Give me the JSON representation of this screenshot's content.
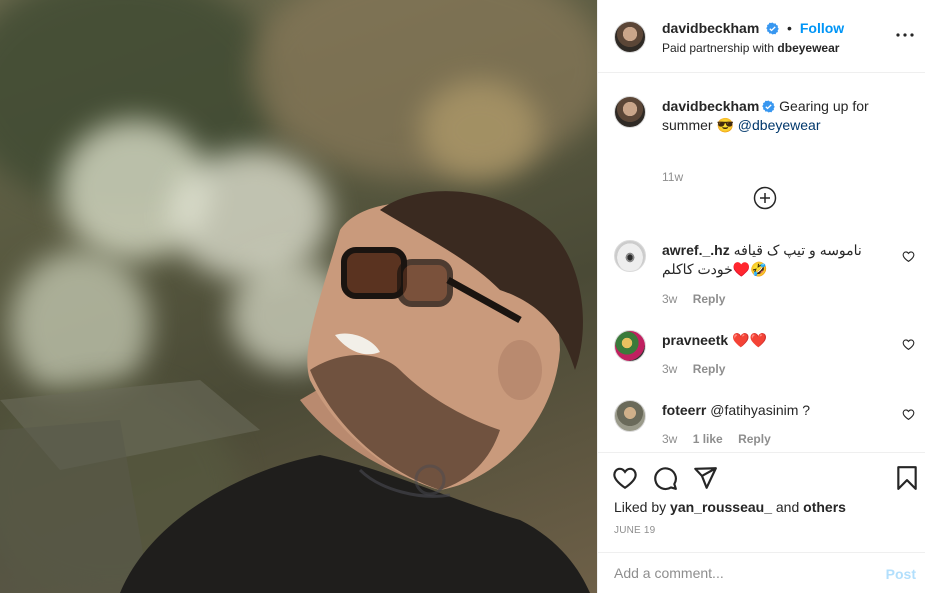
{
  "post": {
    "author": "davidbeckham",
    "follow_label": "Follow",
    "separator": "•",
    "partnership_prefix": "Paid partnership with",
    "partner": "dbeyewear"
  },
  "caption": {
    "author": "davidbeckham",
    "text": "Gearing up for summer",
    "emoji": "😎",
    "mention": "@dbeyewear",
    "time": "11w"
  },
  "comments": [
    {
      "user": "awref._.hz",
      "text": "ناموسه و تیپ ک قیافه خودت کاکلم♥️🤣",
      "time": "3w",
      "likes": "",
      "reply": "Reply"
    },
    {
      "user": "pravneetk",
      "text": "❤️❤️",
      "time": "3w",
      "likes": "",
      "reply": "Reply"
    },
    {
      "user": "foteerr",
      "text": "@fatihyasinim ?",
      "time": "3w",
      "likes": "1 like",
      "reply": "Reply"
    }
  ],
  "engagement": {
    "liked_by_prefix": "Liked by",
    "liked_by_user": "yan_rousseau_",
    "liked_by_and": "and",
    "liked_by_others": "others",
    "date": "JUNE 19"
  },
  "composer": {
    "placeholder": "Add a comment...",
    "post_label": "Post"
  },
  "colors": {
    "accent": "#0095f6",
    "verified": "#3897f0",
    "post_disabled": "#b2dffc",
    "heart_red": "#ed4956"
  }
}
